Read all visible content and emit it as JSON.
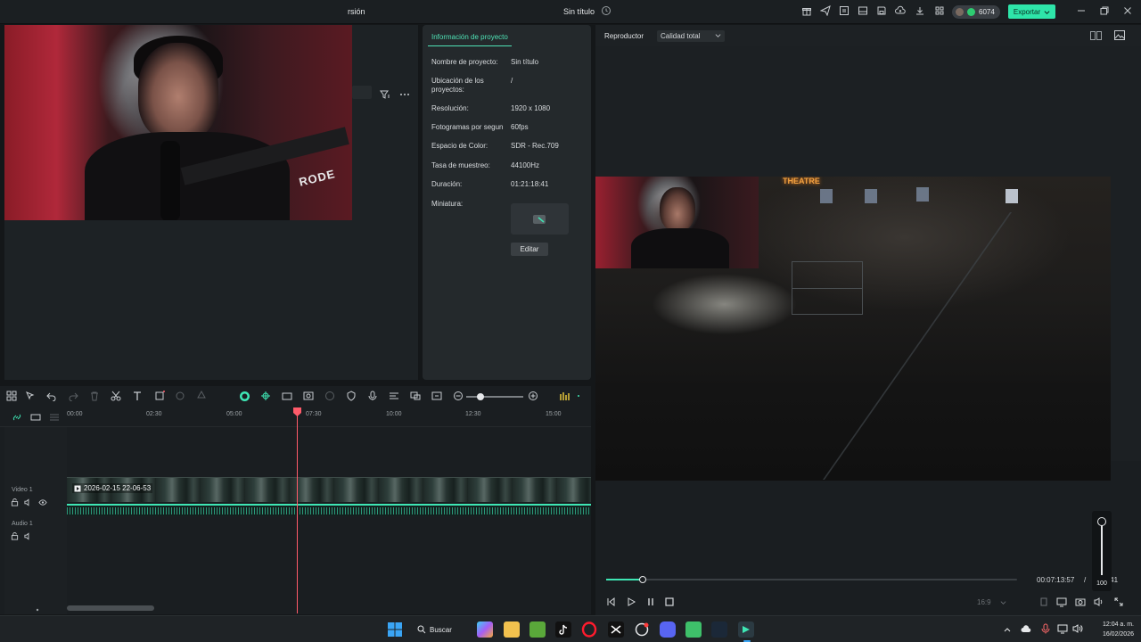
{
  "titlebar": {
    "partial_menu": "rsión",
    "project_title": "Sin título",
    "credits": "6074",
    "export_label": "Exportar"
  },
  "project_info": {
    "tab": "Información de proyecto",
    "rows": [
      {
        "label": "Nombre de proyecto:",
        "value": "Sin título"
      },
      {
        "label": "Ubicación de los proyectos:",
        "value": "/"
      },
      {
        "label": "Resolución:",
        "value": "1920 x 1080"
      },
      {
        "label": "Fotogramas por segun",
        "value": "60fps"
      },
      {
        "label": "Espacio de Color:",
        "value": "SDR - Rec.709"
      },
      {
        "label": "Tasa de muestreo:",
        "value": "44100Hz"
      },
      {
        "label": "Duración:",
        "value": "01:21:18:41"
      },
      {
        "label": "Miniatura:",
        "value": ""
      }
    ],
    "edit_label": "Editar"
  },
  "webcam": {
    "mic_brand": "RODE"
  },
  "player": {
    "title": "Reproductor",
    "quality": "Calidad total",
    "current_time": "00:07:13:57",
    "separator": "/",
    "total_time_partial": "18:41",
    "progress_fraction": 0.09,
    "volume_value": "100",
    "ratio": "16:9",
    "scene_sign": "THEATRE"
  },
  "timeline": {
    "ruler": [
      "00:00",
      "02:30",
      "05:00",
      "07:30",
      "10:00",
      "12:30",
      "15:00"
    ],
    "video_track": "Video 1",
    "audio_track": "Audio 1",
    "clip_name": "2026-02-15 22-06-53"
  },
  "taskbar": {
    "search_label": "Buscar",
    "time": "12:04 a. m.",
    "date": "16/02/2026"
  },
  "colors": {
    "accent": "#3ee6b4",
    "export": "#2ee5a9",
    "playhead": "#ff5b6a"
  }
}
